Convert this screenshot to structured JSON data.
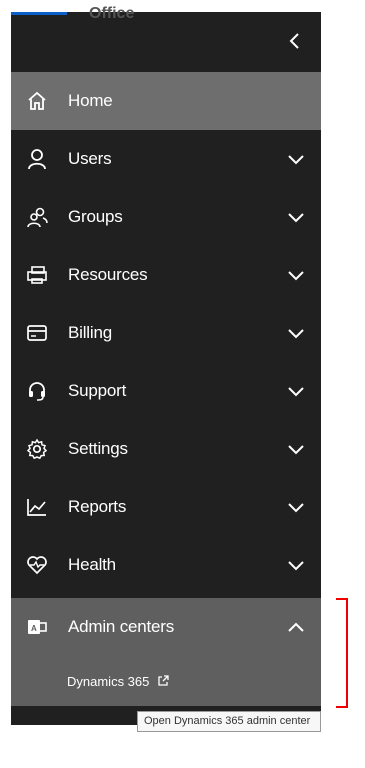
{
  "header": {
    "partial_text": "Office"
  },
  "nav": {
    "collapse_label": "Collapse navigation",
    "items": [
      {
        "label": "Home",
        "icon": "home-icon"
      },
      {
        "label": "Users",
        "icon": "user-icon"
      },
      {
        "label": "Groups",
        "icon": "groups-icon"
      },
      {
        "label": "Resources",
        "icon": "resources-icon"
      },
      {
        "label": "Billing",
        "icon": "billing-icon"
      },
      {
        "label": "Support",
        "icon": "headset-icon"
      },
      {
        "label": "Settings",
        "icon": "gear-icon"
      },
      {
        "label": "Reports",
        "icon": "chart-icon"
      },
      {
        "label": "Health",
        "icon": "heart-icon"
      }
    ],
    "admin": {
      "label": "Admin centers",
      "icon": "admin-centers-icon",
      "sub_label": "Dynamics 365"
    }
  },
  "tooltip": {
    "text": "Open Dynamics 365 admin center"
  },
  "colors": {
    "nav_bg": "#202020",
    "active_bg": "#6e6e6e",
    "section_bg": "#5f5f5f",
    "highlight": "#e00000",
    "accent": "#0a5fc9"
  }
}
